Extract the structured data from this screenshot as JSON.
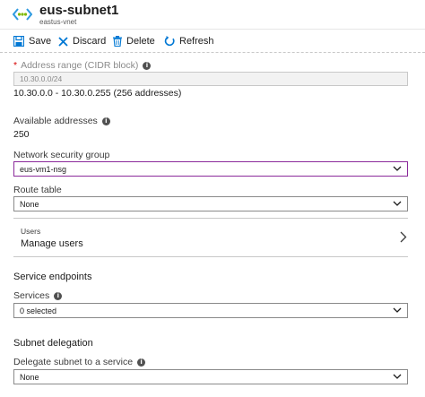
{
  "header": {
    "title": "eus-subnet1",
    "subtitle": "eastus-vnet",
    "logo_icon": "subnet-icon"
  },
  "toolbar": {
    "save_label": "Save",
    "discard_label": "Discard",
    "delete_label": "Delete",
    "refresh_label": "Refresh"
  },
  "form": {
    "address_range": {
      "required_mark": "*",
      "label": "Address range (CIDR block)",
      "value": "10.30.0.0/24",
      "range_text": "10.30.0.0 - 10.30.0.255 (256 addresses)"
    },
    "available": {
      "label": "Available addresses",
      "value": "250"
    },
    "nsg": {
      "label": "Network security group",
      "value": "eus-vm1-nsg"
    },
    "route_table": {
      "label": "Route table",
      "value": "None"
    },
    "users": {
      "label": "Users",
      "link": "Manage users"
    },
    "service_endpoints": {
      "heading": "Service endpoints",
      "services_label": "Services",
      "services_value": "0 selected"
    },
    "delegation": {
      "heading": "Subnet delegation",
      "label": "Delegate subnet to a service",
      "value": "None"
    }
  },
  "colors": {
    "accent": "#0078d4",
    "focus_border": "#8b2a9b",
    "required": "#d60000"
  }
}
